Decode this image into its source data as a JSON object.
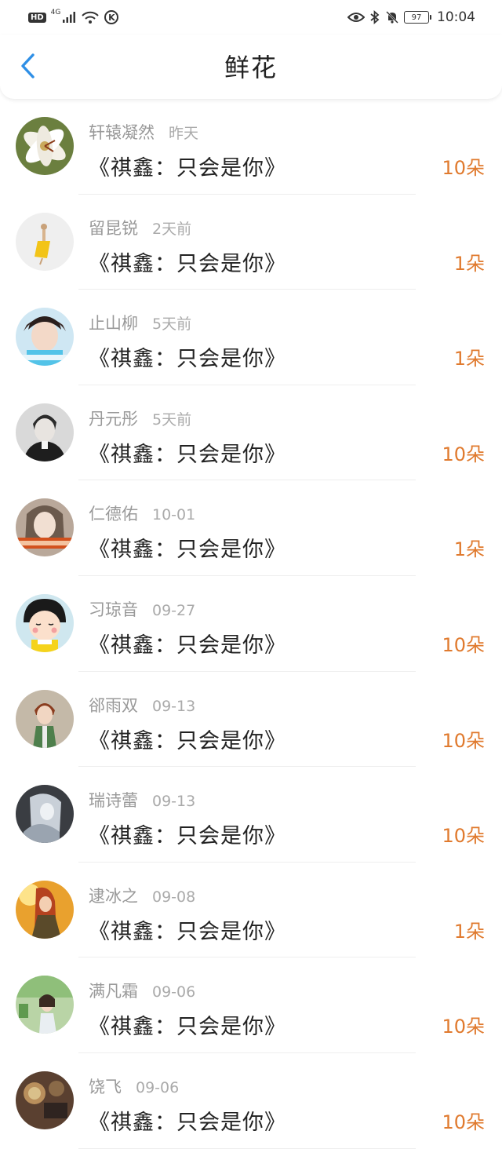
{
  "status_bar": {
    "hd": "HD",
    "network": "4G",
    "k_badge": "K",
    "battery": "97",
    "time": "10:04"
  },
  "header": {
    "title": "鲜花",
    "back_icon": "chevron-left-icon"
  },
  "colors": {
    "accent": "#2f8fe6",
    "amount": "#e07a2e"
  },
  "items": [
    {
      "name": "轩辕凝然",
      "time": "昨天",
      "book": "《祺鑫：只会是你》",
      "amount": "10朵"
    },
    {
      "name": "留昆锐",
      "time": "2天前",
      "book": "《祺鑫：只会是你》",
      "amount": "1朵"
    },
    {
      "name": "止山柳",
      "time": "5天前",
      "book": "《祺鑫：只会是你》",
      "amount": "1朵"
    },
    {
      "name": "丹元彤",
      "time": "5天前",
      "book": "《祺鑫：只会是你》",
      "amount": "10朵"
    },
    {
      "name": "仁德佑",
      "time": "10-01",
      "book": "《祺鑫：只会是你》",
      "amount": "1朵"
    },
    {
      "name": "习琼音",
      "time": "09-27",
      "book": "《祺鑫：只会是你》",
      "amount": "10朵"
    },
    {
      "name": "郤雨双",
      "time": "09-13",
      "book": "《祺鑫：只会是你》",
      "amount": "10朵"
    },
    {
      "name": "瑞诗蕾",
      "time": "09-13",
      "book": "《祺鑫：只会是你》",
      "amount": "10朵"
    },
    {
      "name": "逮冰之",
      "time": "09-08",
      "book": "《祺鑫：只会是你》",
      "amount": "1朵"
    },
    {
      "name": "满凡霜",
      "time": "09-06",
      "book": "《祺鑫：只会是你》",
      "amount": "10朵"
    },
    {
      "name": "饶飞",
      "time": "09-06",
      "book": "《祺鑫：只会是你》",
      "amount": "10朵"
    }
  ]
}
